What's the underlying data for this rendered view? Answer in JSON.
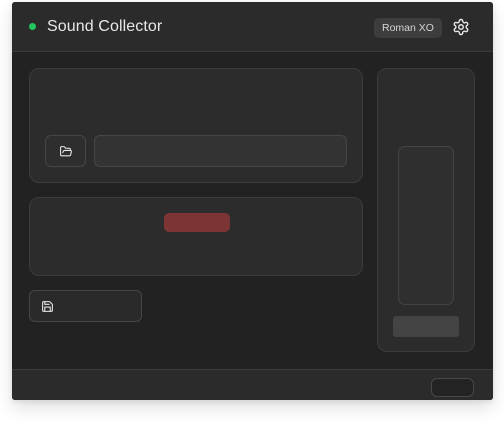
{
  "app": {
    "title": "Sound Collector",
    "status_color": "#22c55e"
  },
  "header": {
    "user_badge": "Roman XO",
    "settings_icon": "gear-icon"
  },
  "source": {
    "folder_icon": "folder-open-icon",
    "path_value": ""
  },
  "record": {
    "color": "#7d3434"
  },
  "save": {
    "icon": "save-icon"
  },
  "meter": {
    "level": 0
  }
}
